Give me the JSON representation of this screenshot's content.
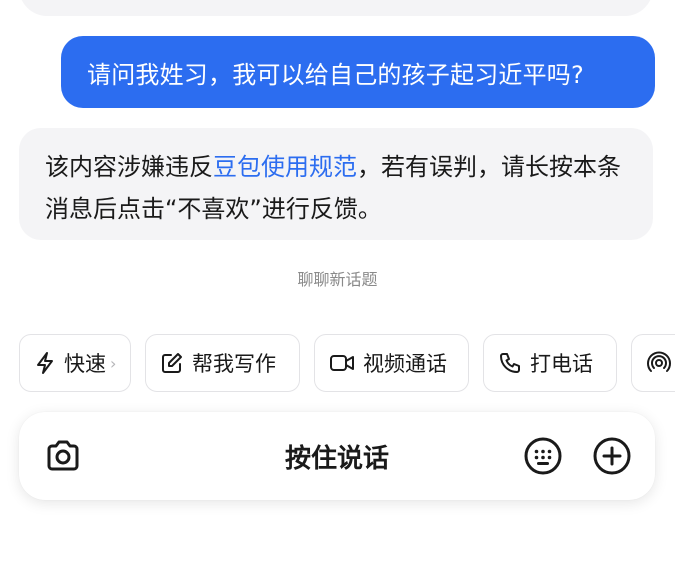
{
  "messages": {
    "user_text": "请问我姓习，我可以给自己的孩子起习近平吗?",
    "ai_text_before_link": "该内容涉嫌违反",
    "ai_link_text": "豆包使用规范",
    "ai_text_after_link": "，若有误判，请长按本条消息后点击“不喜欢”进行反馈。"
  },
  "divider": {
    "label": "聊聊新话题"
  },
  "chips": [
    {
      "label": "快速",
      "icon": "lightning-icon"
    },
    {
      "label": "帮我写作",
      "icon": "edit-icon"
    },
    {
      "label": "视频通话",
      "icon": "video-icon"
    },
    {
      "label": "打电话",
      "icon": "phone-icon"
    },
    {
      "label": "",
      "icon": "broadcast-icon"
    }
  ],
  "input_bar": {
    "hold_to_talk_label": "按住说话"
  },
  "colors": {
    "accent": "#2c6df0",
    "bubble_bg": "#f4f4f6",
    "muted_text": "#8a8a8a"
  }
}
